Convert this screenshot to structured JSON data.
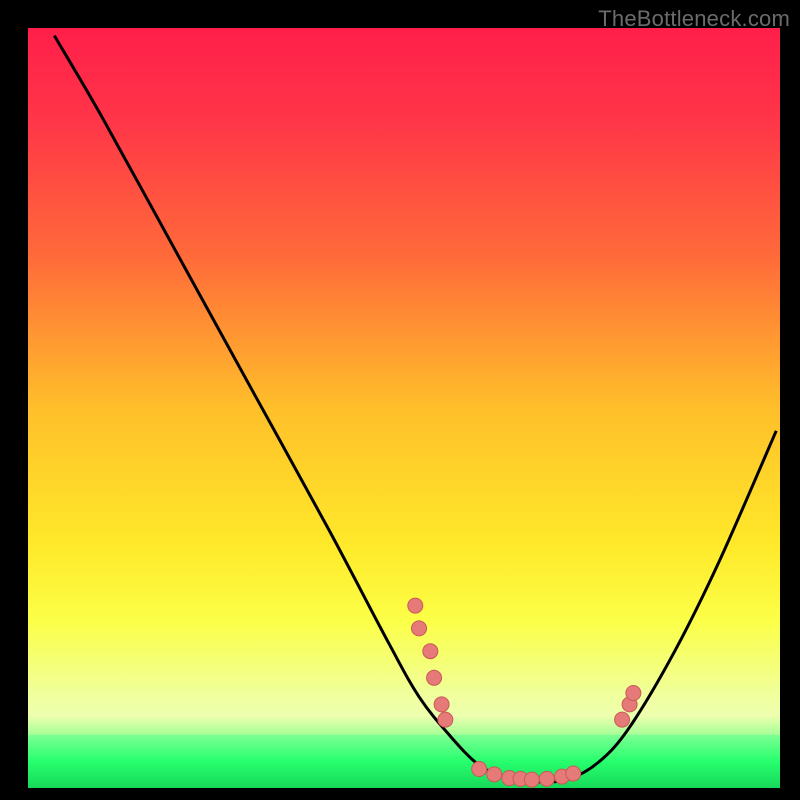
{
  "watermark": "TheBottleneck.com",
  "colors": {
    "bg": "#000000",
    "watermark_text": "#6b6b6b",
    "curve": "#000000",
    "dot_fill": "#e67a78",
    "dot_stroke": "#c85956",
    "green_band_top": "#27ff6e",
    "green_band_bottom": "#17d95a",
    "pale_band": "#f7ff9f"
  },
  "chart_data": {
    "type": "line",
    "title": "",
    "xlabel": "",
    "ylabel": "",
    "xlim": [
      0,
      100
    ],
    "ylim": [
      0,
      100
    ],
    "gradient_stops": [
      {
        "offset": 0.0,
        "color": "#ff1f4a"
      },
      {
        "offset": 0.12,
        "color": "#ff3548"
      },
      {
        "offset": 0.3,
        "color": "#ff6a3a"
      },
      {
        "offset": 0.5,
        "color": "#ffbf2a"
      },
      {
        "offset": 0.68,
        "color": "#ffe92a"
      },
      {
        "offset": 0.78,
        "color": "#fbff47"
      },
      {
        "offset": 0.86,
        "color": "#f2ff8c"
      },
      {
        "offset": 0.905,
        "color": "#e8ffb8"
      },
      {
        "offset": 0.93,
        "color": "#7dff93"
      },
      {
        "offset": 0.965,
        "color": "#27ff6e"
      },
      {
        "offset": 1.0,
        "color": "#17d95a"
      }
    ],
    "curve": [
      {
        "x": 3.5,
        "y": 99.0
      },
      {
        "x": 10.0,
        "y": 88.0
      },
      {
        "x": 20.0,
        "y": 70.0
      },
      {
        "x": 30.0,
        "y": 52.0
      },
      {
        "x": 40.0,
        "y": 34.0
      },
      {
        "x": 48.0,
        "y": 19.0
      },
      {
        "x": 52.0,
        "y": 12.0
      },
      {
        "x": 56.0,
        "y": 7.0
      },
      {
        "x": 60.0,
        "y": 3.0
      },
      {
        "x": 64.0,
        "y": 1.2
      },
      {
        "x": 68.0,
        "y": 0.8
      },
      {
        "x": 72.0,
        "y": 1.2
      },
      {
        "x": 76.0,
        "y": 3.5
      },
      {
        "x": 80.0,
        "y": 8.0
      },
      {
        "x": 86.0,
        "y": 18.0
      },
      {
        "x": 92.0,
        "y": 30.0
      },
      {
        "x": 99.5,
        "y": 47.0
      }
    ],
    "dots": [
      {
        "x": 51.5,
        "y": 24.0
      },
      {
        "x": 52.0,
        "y": 21.0
      },
      {
        "x": 53.5,
        "y": 18.0
      },
      {
        "x": 54.0,
        "y": 14.5
      },
      {
        "x": 55.0,
        "y": 11.0
      },
      {
        "x": 55.5,
        "y": 9.0
      },
      {
        "x": 60.0,
        "y": 2.5
      },
      {
        "x": 62.0,
        "y": 1.8
      },
      {
        "x": 64.0,
        "y": 1.3
      },
      {
        "x": 65.5,
        "y": 1.2
      },
      {
        "x": 67.0,
        "y": 1.1
      },
      {
        "x": 69.0,
        "y": 1.2
      },
      {
        "x": 71.0,
        "y": 1.5
      },
      {
        "x": 72.5,
        "y": 1.9
      },
      {
        "x": 79.0,
        "y": 9.0
      },
      {
        "x": 80.0,
        "y": 11.0
      },
      {
        "x": 80.5,
        "y": 12.5
      }
    ]
  }
}
